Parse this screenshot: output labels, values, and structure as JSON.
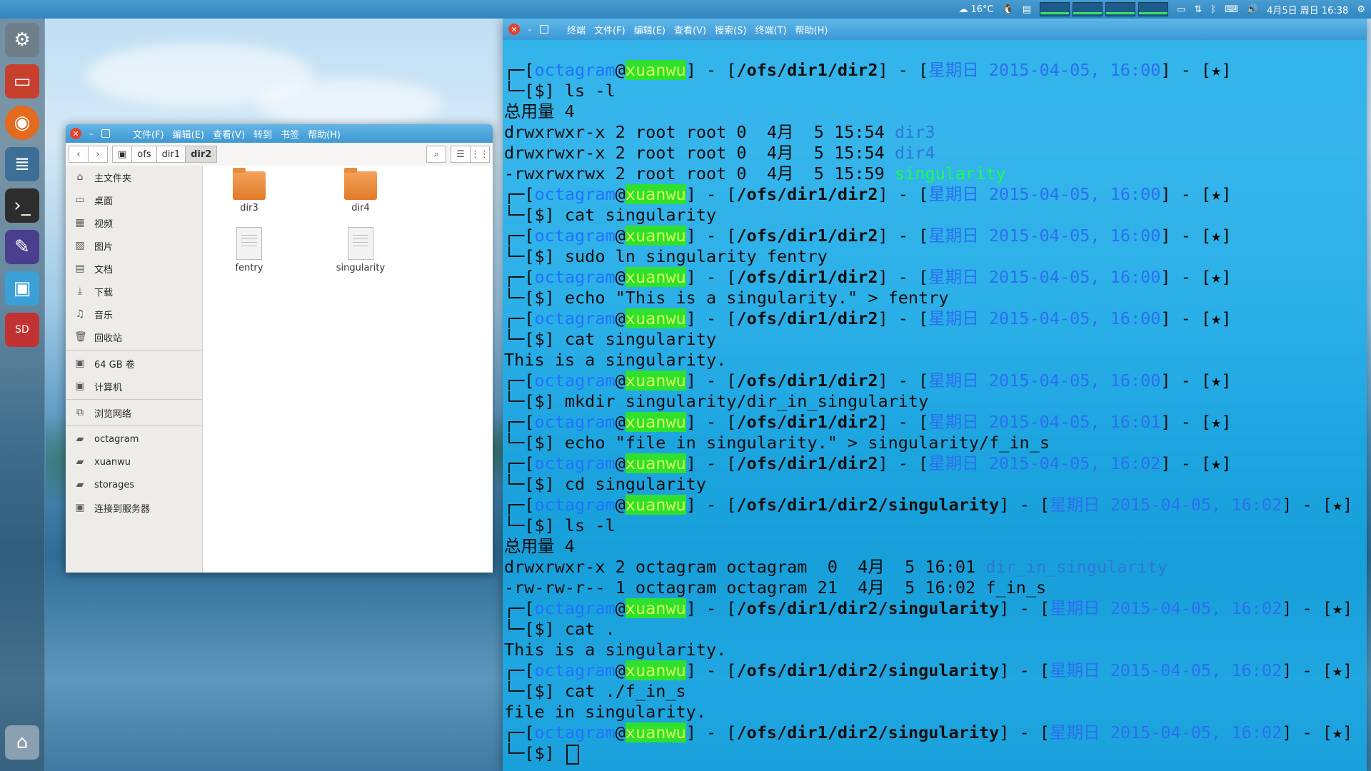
{
  "panel": {
    "weather": "16°C",
    "datetime": "4月5日 周日 16:38"
  },
  "file_manager": {
    "menu": [
      "文件(F)",
      "编辑(E)",
      "查看(V)",
      "转到",
      "书签",
      "帮助(H)"
    ],
    "breadcrumbs": [
      "ofs",
      "dir1",
      "dir2"
    ],
    "sidebar_places": [
      "主文件夹",
      "桌面",
      "视频",
      "图片",
      "文档",
      "下载",
      "音乐",
      "回收站"
    ],
    "sidebar_devices": [
      "64 GB 卷",
      "计算机"
    ],
    "sidebar_network": [
      "浏览网络"
    ],
    "sidebar_bookmarks": [
      "octagram",
      "xuanwu",
      "storages",
      "连接到服务器"
    ],
    "files": [
      {
        "name": "dir3",
        "type": "folder"
      },
      {
        "name": "dir4",
        "type": "folder"
      },
      {
        "name": "fentry",
        "type": "file"
      },
      {
        "name": "singularity",
        "type": "file"
      }
    ]
  },
  "terminal": {
    "menu": [
      "终端",
      "文件(F)",
      "编辑(E)",
      "查看(V)",
      "搜索(S)",
      "终端(T)",
      "帮助(H)"
    ],
    "lines": [
      {
        "t": "p",
        "path": "/ofs/dir1/dir2",
        "time": "16:00"
      },
      {
        "t": "c",
        "text": "ls -l"
      },
      {
        "t": "o",
        "text": "总用量 4"
      },
      {
        "t": "ls",
        "text": "drwxrwxr-x 2 root root 0  4月  5 15:54 ",
        "name": "dir3",
        "cls": "d"
      },
      {
        "t": "ls",
        "text": "drwxrwxr-x 2 root root 0  4月  5 15:54 ",
        "name": "dir4",
        "cls": "d"
      },
      {
        "t": "ls",
        "text": "-rwxrwxrwx 2 root root 0  4月  5 15:59 ",
        "name": "singularity",
        "cls": "ln"
      },
      {
        "t": "p",
        "path": "/ofs/dir1/dir2",
        "time": "16:00"
      },
      {
        "t": "c",
        "text": "cat singularity"
      },
      {
        "t": "p",
        "path": "/ofs/dir1/dir2",
        "time": "16:00"
      },
      {
        "t": "c",
        "text": "sudo ln singularity fentry"
      },
      {
        "t": "p",
        "path": "/ofs/dir1/dir2",
        "time": "16:00"
      },
      {
        "t": "c",
        "text": "echo \"This is a singularity.\" > fentry"
      },
      {
        "t": "p",
        "path": "/ofs/dir1/dir2",
        "time": "16:00"
      },
      {
        "t": "c",
        "text": "cat singularity"
      },
      {
        "t": "o",
        "text": "This is a singularity."
      },
      {
        "t": "p",
        "path": "/ofs/dir1/dir2",
        "time": "16:00"
      },
      {
        "t": "c",
        "text": "mkdir singularity/dir_in_singularity"
      },
      {
        "t": "p",
        "path": "/ofs/dir1/dir2",
        "time": "16:01"
      },
      {
        "t": "c",
        "text": "echo \"file in singularity.\" > singularity/f_in_s"
      },
      {
        "t": "p",
        "path": "/ofs/dir1/dir2",
        "time": "16:02"
      },
      {
        "t": "c",
        "text": "cd singularity"
      },
      {
        "t": "p",
        "path": "/ofs/dir1/dir2/singularity",
        "time": "16:02"
      },
      {
        "t": "c",
        "text": "ls -l"
      },
      {
        "t": "o",
        "text": "总用量 4"
      },
      {
        "t": "ls",
        "text": "drwxrwxr-x 2 octagram octagram  0  4月  5 16:01 ",
        "name": "dir_in_singularity",
        "cls": "d"
      },
      {
        "t": "o",
        "text": "-rw-rw-r-- 1 octagram octagram 21  4月  5 16:02 f_in_s"
      },
      {
        "t": "p",
        "path": "/ofs/dir1/dir2/singularity",
        "time": "16:02"
      },
      {
        "t": "c",
        "text": "cat ."
      },
      {
        "t": "o",
        "text": "This is a singularity."
      },
      {
        "t": "p",
        "path": "/ofs/dir1/dir2/singularity",
        "time": "16:02"
      },
      {
        "t": "c",
        "text": "cat ./f_in_s"
      },
      {
        "t": "o",
        "text": "file in singularity."
      },
      {
        "t": "p",
        "path": "/ofs/dir1/dir2/singularity",
        "time": "16:02"
      },
      {
        "t": "cur",
        "text": ""
      }
    ],
    "prompt": {
      "user": "octagram",
      "host": "xuanwu",
      "day": "星期日",
      "date": "2015-04-05",
      "star": "★",
      "sym": "[$]"
    }
  },
  "colors": {
    "terminal_bg": "#12aae8",
    "host_bg": "#2fe02f",
    "folder": "#e07b25"
  }
}
